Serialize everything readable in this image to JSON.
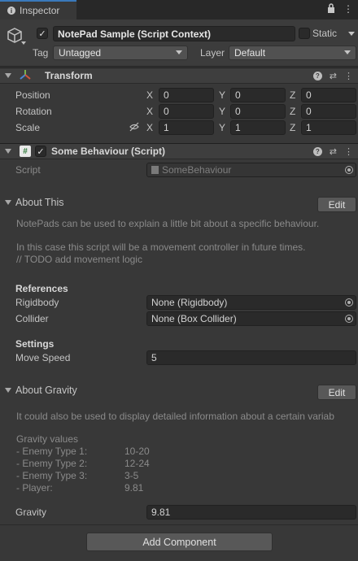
{
  "tab": {
    "title": "Inspector"
  },
  "object": {
    "name": "NotePad Sample (Script Context)",
    "static_label": "Static",
    "tag_label": "Tag",
    "tag_value": "Untagged",
    "layer_label": "Layer",
    "layer_value": "Default"
  },
  "transform": {
    "title": "Transform",
    "rows": [
      {
        "label": "Position",
        "x": "0",
        "y": "0",
        "z": "0"
      },
      {
        "label": "Rotation",
        "x": "0",
        "y": "0",
        "z": "0"
      },
      {
        "label": "Scale",
        "x": "1",
        "y": "1",
        "z": "1"
      }
    ],
    "axes": {
      "x": "X",
      "y": "Y",
      "z": "Z"
    }
  },
  "behaviour": {
    "title": "Some Behaviour (Script)",
    "script_label": "Script",
    "script_value": "SomeBehaviour",
    "about_this": {
      "title": "About This",
      "edit_label": "Edit",
      "line1": "NotePads can be used to explain a little bit about a specific behaviour.",
      "line2": "In this case this script will be a movement controller in future times.",
      "line3": "// TODO add movement logic"
    },
    "references": {
      "header": "References",
      "rigidbody_label": "Rigidbody",
      "rigidbody_value": "None (Rigidbody)",
      "collider_label": "Collider",
      "collider_value": "None (Box Collider)"
    },
    "settings": {
      "header": "Settings",
      "move_speed_label": "Move Speed",
      "move_speed_value": "5"
    },
    "about_gravity": {
      "title": "About Gravity",
      "edit_label": "Edit",
      "line1": "It could also be used to display detailed information about a certain variab",
      "list_header": "Gravity values",
      "items": [
        {
          "name": "- Enemy Type 1:",
          "value": "10-20"
        },
        {
          "name": "- Enemy Type 2:",
          "value": "12-24"
        },
        {
          "name": "- Enemy Type 3:",
          "value": "3-5"
        },
        {
          "name": "- Player:",
          "value": "9.81"
        }
      ]
    },
    "gravity_label": "Gravity",
    "gravity_value": "9.81"
  },
  "add_component_label": "Add Component"
}
